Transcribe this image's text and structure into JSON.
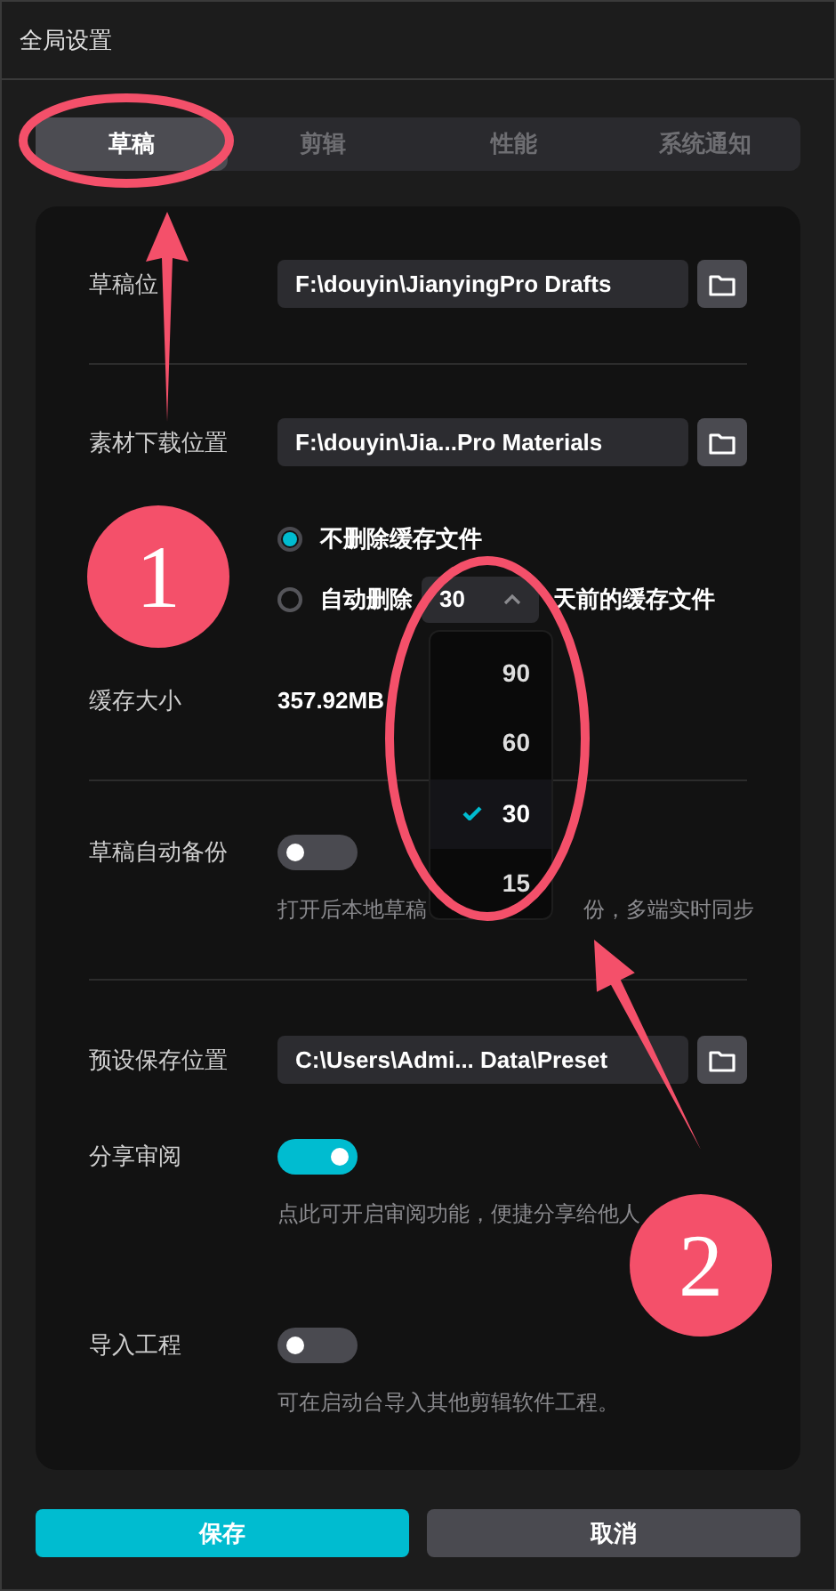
{
  "window": {
    "title": "全局设置"
  },
  "tabs": [
    {
      "label": "草稿",
      "selected": true
    },
    {
      "label": "剪辑",
      "selected": false
    },
    {
      "label": "性能",
      "selected": false
    },
    {
      "label": "系统通知",
      "selected": false
    }
  ],
  "sections": [
    {
      "items": [
        {
          "kind": "path",
          "label": "草稿位",
          "value": "F:\\douyin\\JianyingPro Drafts"
        }
      ]
    },
    {
      "items": [
        {
          "kind": "path",
          "label": "素材下载位置",
          "value": "F:\\douyin\\Jia...Pro Materials"
        },
        {
          "kind": "cache",
          "options": [
            {
              "kind": "plain",
              "label": "不删除缓存文件",
              "selected": true
            },
            {
              "kind": "auto",
              "prefix": "自动删除",
              "value": "30",
              "suffix": "天前的缓存文件",
              "selected": false,
              "dropdown": {
                "expanded": true,
                "options": [
                  {
                    "label": "90",
                    "selected": false
                  },
                  {
                    "label": "60",
                    "selected": false
                  },
                  {
                    "label": "30",
                    "selected": true
                  },
                  {
                    "label": "15",
                    "selected": false
                  }
                ]
              }
            }
          ]
        },
        {
          "kind": "info",
          "label": "缓存大小",
          "value": "357.92MB"
        }
      ]
    },
    {
      "items": [
        {
          "kind": "toggle",
          "label": "草稿自动备份",
          "on": false,
          "hint": [
            "打开后本地草稿",
            "份，多端实时同步"
          ]
        }
      ]
    },
    {
      "items": [
        {
          "kind": "path",
          "label": "预设保存位置",
          "value": "C:\\Users\\Admi... Data\\Preset"
        },
        {
          "kind": "toggle",
          "label": "分享审阅",
          "on": true,
          "hint": [
            "点此可开启审阅功能，便捷分享给他人"
          ]
        },
        {
          "kind": "toggle",
          "label": "导入工程",
          "on": false,
          "hint": [
            "可在启动台导入其他剪辑软件工程。"
          ]
        }
      ]
    }
  ],
  "buttons": [
    {
      "kind": "primary",
      "label": "保存"
    },
    {
      "kind": "secondary",
      "label": "取消"
    }
  ],
  "annotations": [
    {
      "kind": "ellipse"
    },
    {
      "kind": "arrow"
    },
    {
      "kind": "badge",
      "label": "1"
    },
    {
      "kind": "ellipse"
    },
    {
      "kind": "arrow"
    },
    {
      "kind": "badge",
      "label": "2"
    }
  ]
}
